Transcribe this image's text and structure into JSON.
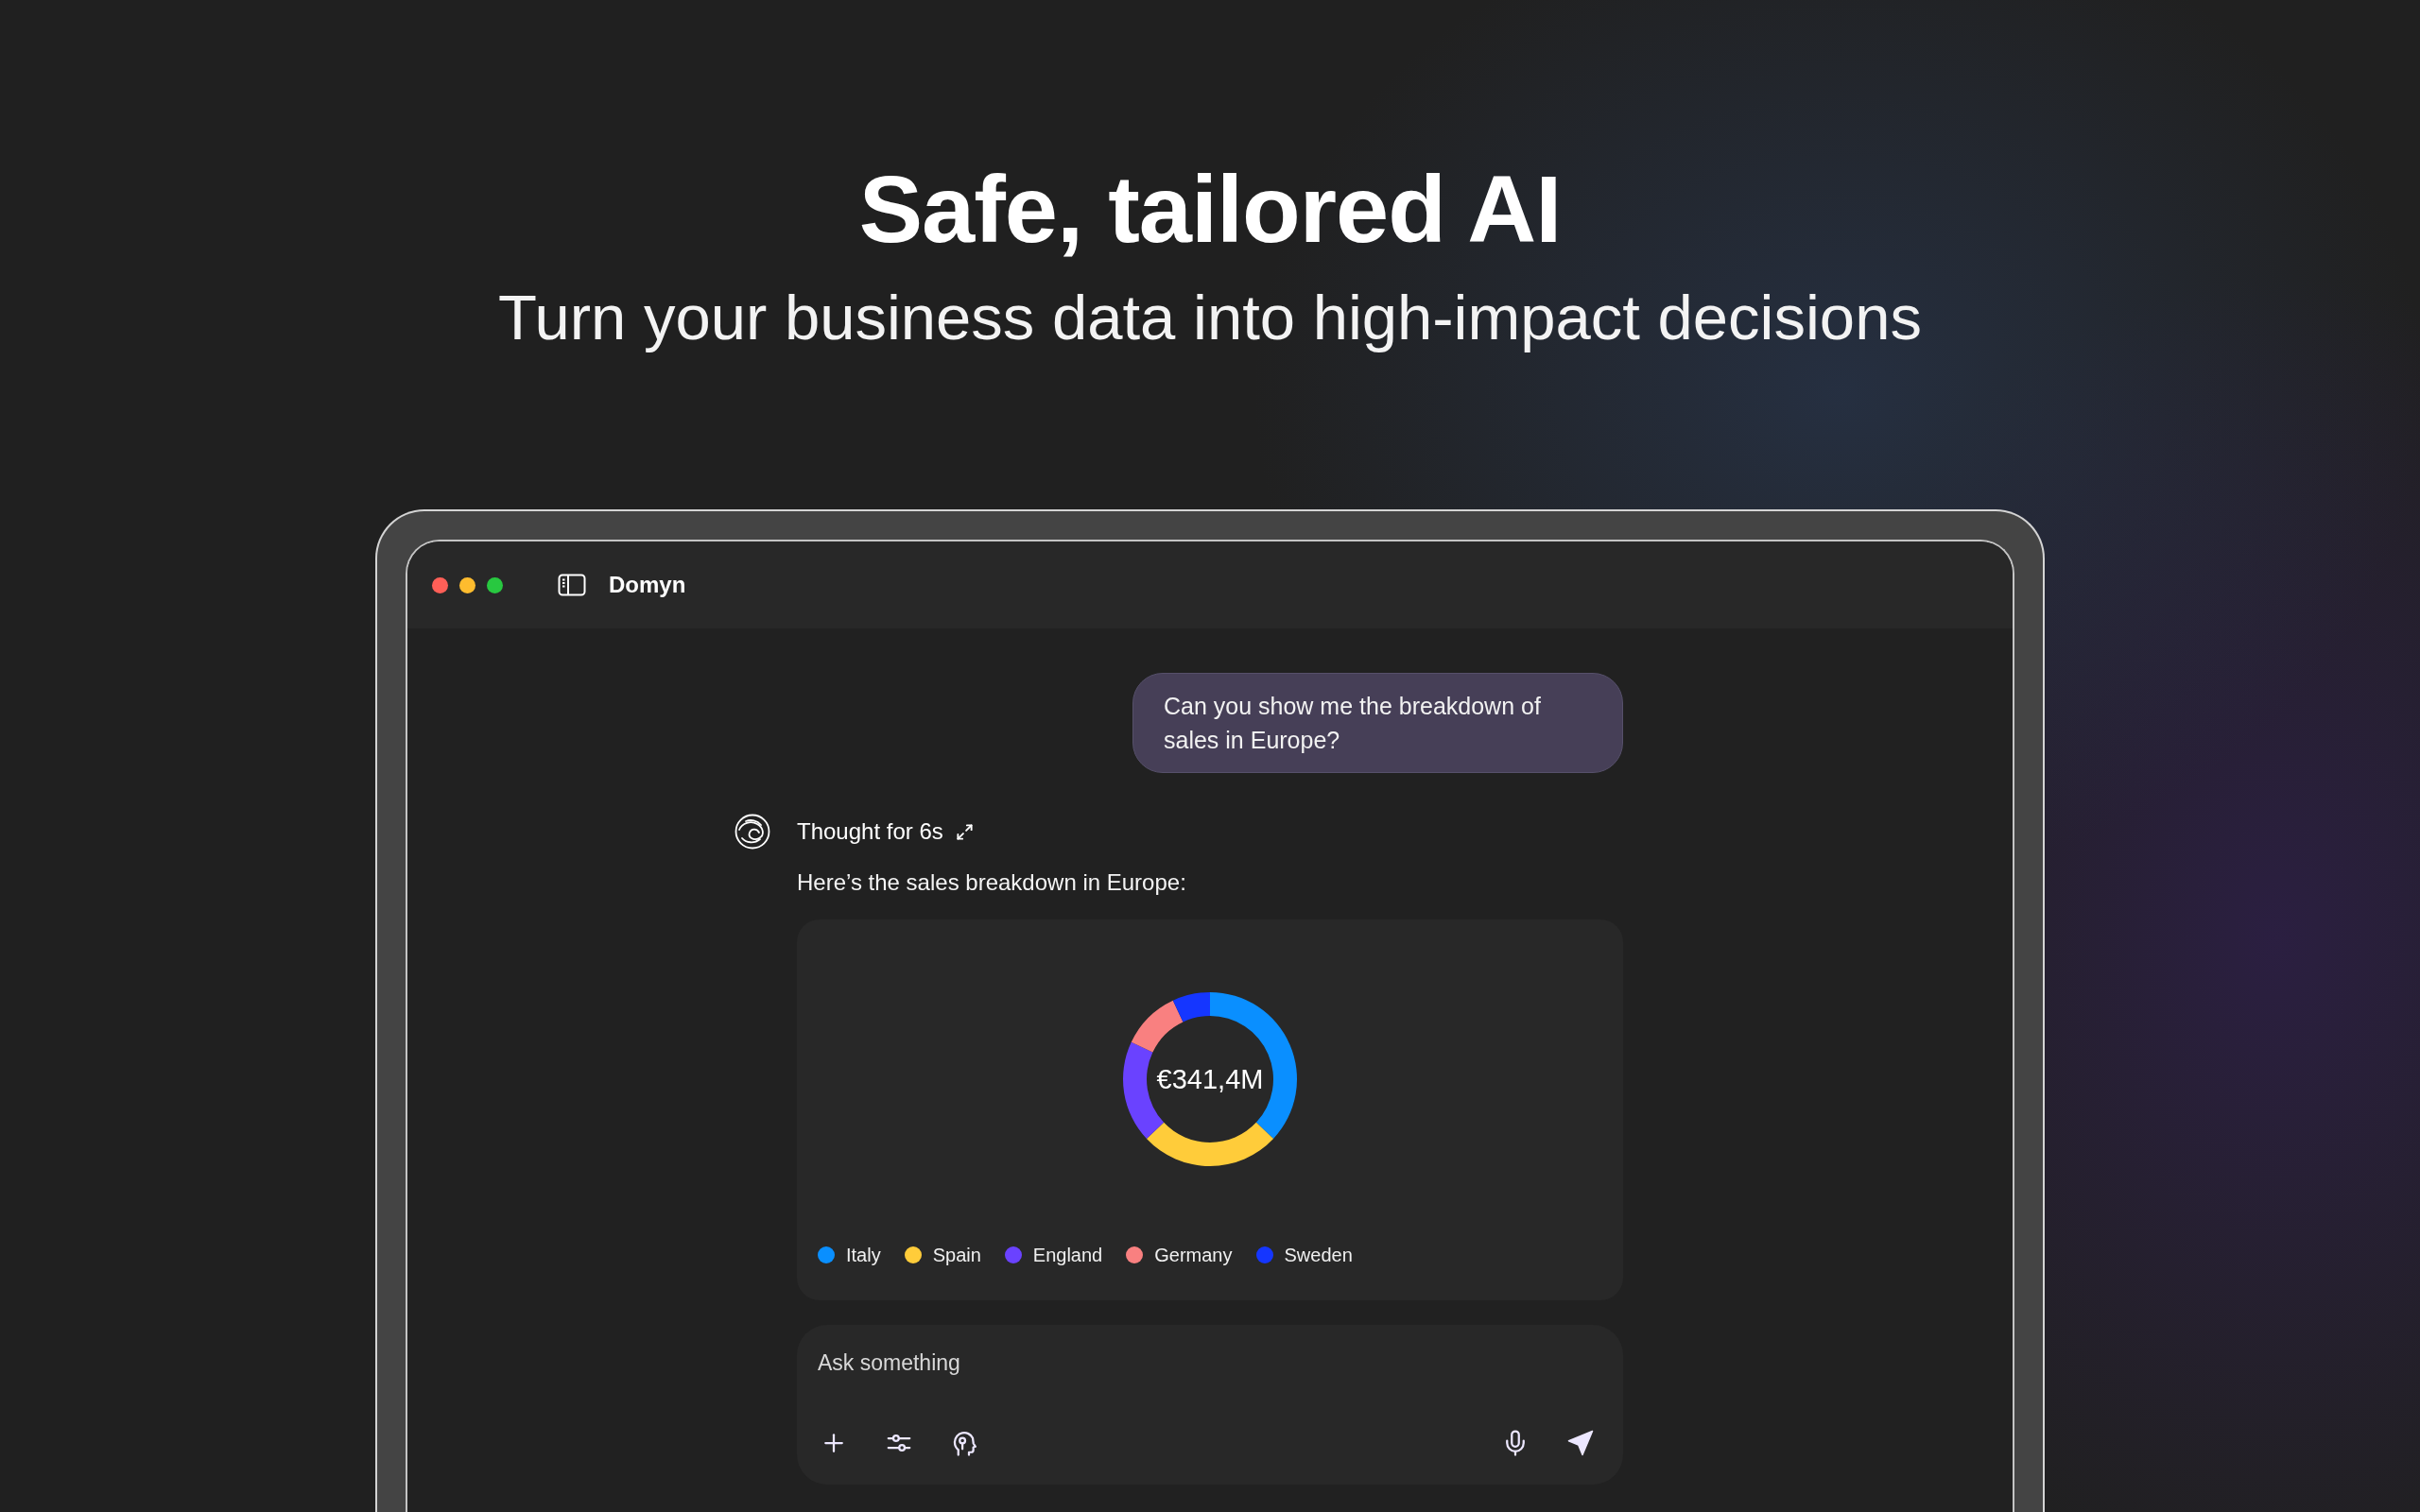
{
  "hero": {
    "title": "Safe, tailored AI",
    "subtitle": "Turn your business data into high-impact decisions"
  },
  "window": {
    "title": "Domyn"
  },
  "chat": {
    "user_message": "Can you show me the breakdown of sales in Europe?",
    "thought_label": "Thought for 6s",
    "reply": "Here’s the sales breakdown in Europe:",
    "chart_data": [
      {
        "type": "donut",
        "annotations": [
          "€341,4M"
        ],
        "categories": [
          "Italy",
          "Spain",
          "England",
          "Germany",
          "Sweden"
        ],
        "values": [
          37,
          26,
          19,
          11,
          7
        ],
        "colors": [
          "#0a8fff",
          "#ffcc3a",
          "#6a42ff",
          "#f98080",
          "#1536ff"
        ],
        "legend": "bottom"
      }
    ]
  },
  "composer": {
    "placeholder": "Ask something"
  }
}
